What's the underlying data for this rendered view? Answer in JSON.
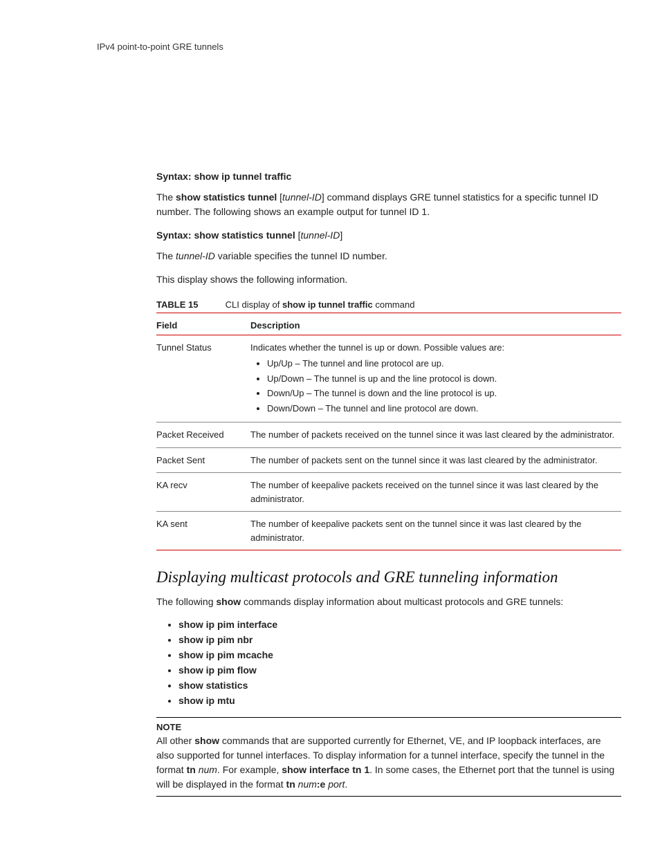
{
  "runningHead": "IPv4 point-to-point GRE tunnels",
  "syntax1": {
    "label": "Syntax:",
    "cmd": "show ip tunnel traffic"
  },
  "para1": {
    "pre": "The ",
    "bold1": "show statistics tunnel",
    "mid1": " [",
    "ital1": "tunnel-ID",
    "post1": "] command displays GRE tunnel statistics for a specific tunnel ID number. The following shows an example output for tunnel ID 1."
  },
  "syntax2": {
    "label": "Syntax:",
    "cmd": "show statistics tunnel",
    "bracketOpen": " [",
    "arg": "tunnel-ID",
    "bracketClose": "]"
  },
  "para2": {
    "pre": "The ",
    "ital": "tunnel-ID",
    "post": " variable specifies the tunnel ID number."
  },
  "para3": "This display shows the following information.",
  "tableCaption": {
    "num": "TABLE 15",
    "pre": "CLI display of ",
    "bold": "show ip tunnel traffic",
    "post": " command"
  },
  "table": {
    "headField": "Field",
    "headDesc": "Description",
    "rows": [
      {
        "field": "Tunnel Status",
        "desc": "Indicates whether the tunnel is up or down. Possible values are:",
        "bullets": [
          "Up/Up – The tunnel and line protocol are up.",
          "Up/Down  – The tunnel is up and the line protocol is down.",
          "Down/Up – The tunnel is down and the line protocol is up.",
          "Down/Down – The tunnel and line protocol are down."
        ]
      },
      {
        "field": "Packet Received",
        "desc": "The number of packets received on the tunnel since it was last cleared by the administrator."
      },
      {
        "field": "Packet Sent",
        "desc": "The number of packets sent on the tunnel since it was last cleared by the administrator."
      },
      {
        "field": "KA recv",
        "desc": "The number of keepalive packets received on the tunnel since it was last cleared by the administrator."
      },
      {
        "field": "KA sent",
        "desc": "The number of keepalive packets sent on the tunnel since it was last cleared by the administrator."
      }
    ]
  },
  "sectionHeading": "Displaying multicast protocols and GRE tunneling information",
  "para4": {
    "pre": "The following ",
    "bold": "show",
    "post": " commands display information about multicast protocols and GRE tunnels:"
  },
  "commands": [
    "show ip pim interface",
    "show ip pim nbr",
    "show ip pim mcache",
    "show ip pim flow",
    "show statistics",
    "show ip mtu"
  ],
  "note": {
    "label": "NOTE",
    "t0": "All other ",
    "b0": "show",
    "t1": " commands that are supported currently for Ethernet, VE, and IP loopback interfaces, are also supported for tunnel interfaces. To display information for a tunnel interface, specify the tunnel in the format ",
    "b1": "tn",
    "sp1": " ",
    "i1": "num",
    "t2": ". For example, ",
    "b2": "show interface tn 1",
    "t3": ". In some cases, the Ethernet port that the tunnel is using will be displayed in the format ",
    "b3": "tn",
    "sp2": " ",
    "i2": "num",
    "b4": ":e",
    "sp3": " ",
    "i3": "port",
    "t4": "."
  }
}
